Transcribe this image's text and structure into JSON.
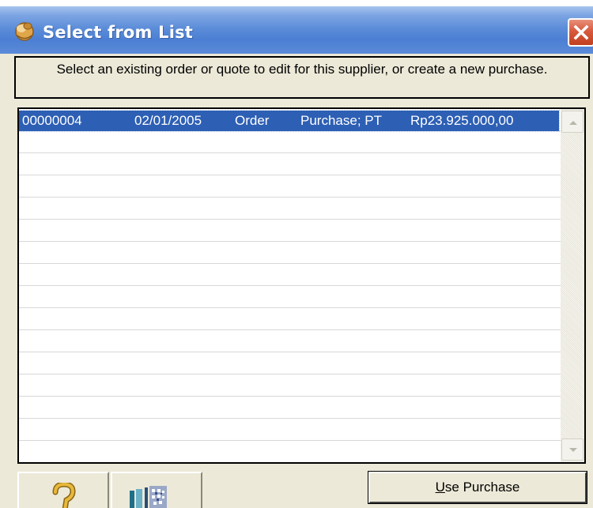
{
  "window": {
    "title": "Select from List",
    "title_icon": "coins-icon",
    "close_icon": "close-icon"
  },
  "instruction": "Select an existing order or quote to edit for this supplier, or create a new purchase.",
  "list": {
    "rows": [
      {
        "number": "00000004",
        "date": "02/01/2005",
        "type": "Order",
        "supplier": "Purchase; PT",
        "amount": "Rp23.925.000,00",
        "selected": true
      }
    ]
  },
  "buttons": {
    "help_icon": "help-hook-icon",
    "calculator_icon": "calculator-icon",
    "use_purchase": {
      "accel": "U",
      "rest": "se Purchase"
    }
  },
  "colors": {
    "selection": "#2d5fb4",
    "titlebar": "#5d8ed9",
    "close": "#d8593d"
  }
}
